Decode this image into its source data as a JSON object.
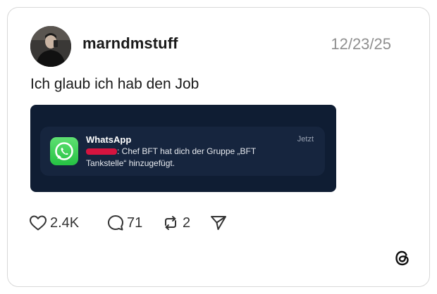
{
  "post": {
    "username": "marndmstuff",
    "date": "12/23/25",
    "text": "Ich glaub ich hab den Job"
  },
  "notification": {
    "app_name": "WhatsApp",
    "time": "Jetzt",
    "body_line1": ": Chef BFT  hat dich der Gruppe „BFT",
    "body_line2": "Tankstelle“ hinzugefügt.",
    "icon": "whatsapp-icon"
  },
  "actions": {
    "likes": "2.4K",
    "comments": "71",
    "reposts": "2"
  },
  "colors": {
    "media_background": "#0f1d33",
    "whatsapp_green": "#25c243",
    "redaction": "#d5143f",
    "date_gray": "#8f8f8f"
  }
}
